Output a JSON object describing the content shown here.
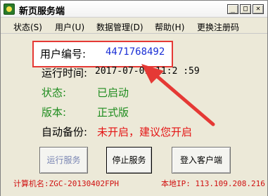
{
  "window": {
    "title": "新页服务端",
    "minimize_glyph": "_",
    "maximize_glyph": "□",
    "close_glyph": "✕"
  },
  "menu": {
    "items": [
      {
        "label": "状态(S)"
      },
      {
        "label": "用户(U)"
      },
      {
        "label": "数据管理(D)"
      },
      {
        "label": "帮助(H)"
      },
      {
        "label": "更换注册码"
      }
    ]
  },
  "info": {
    "user_id_label": "用户编号:",
    "user_id_value": "4471768492",
    "runtime_label": "运行时间:",
    "runtime_value": "2017-07-01 11:2 :59",
    "state_label": "状态:",
    "state_value": "已启动",
    "version_label": "版本:",
    "version_value": "正式版",
    "backup_label": "自动备份:",
    "backup_value": "未开启，建议您开启"
  },
  "buttons": {
    "run": "运行服务",
    "stop": "停止服务",
    "login": "登入客户端"
  },
  "statusbar": {
    "computer_name": "计算机名:ZGC-20130402FPH",
    "local_ip": "本地IP: 113.109.208.216"
  },
  "colors": {
    "green_text": "#1e8c1e",
    "red_text": "#e41414",
    "blue_id": "#1a2fd6",
    "highlight_red": "#e53935"
  }
}
